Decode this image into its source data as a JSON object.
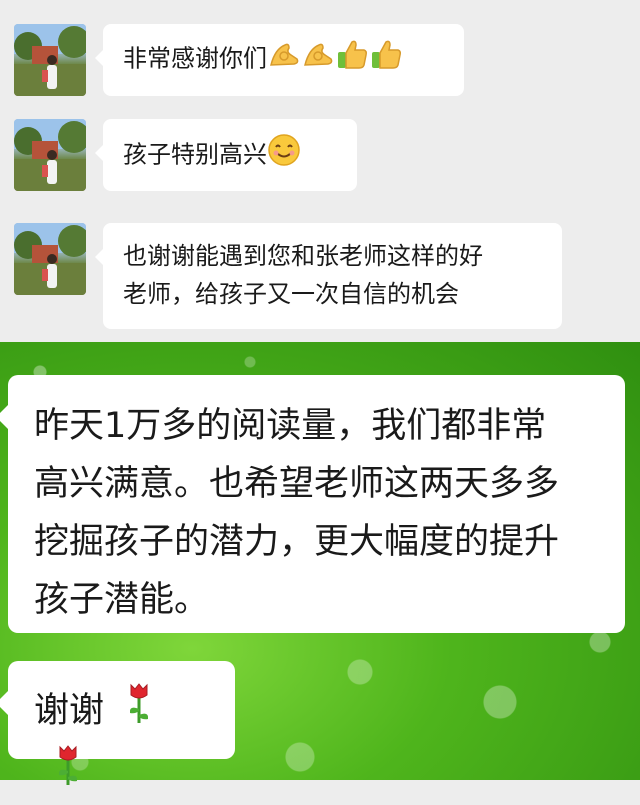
{
  "messages": [
    {
      "text": "非常感谢你们",
      "emojis": [
        "ok-hand-icon",
        "ok-hand-icon",
        "thumbs-up-icon",
        "thumbs-up-icon"
      ]
    },
    {
      "text": "孩子特别高兴",
      "emojis": [
        "smiling-face-icon"
      ]
    },
    {
      "lines": [
        "也谢谢能遇到您和张老师这样的好",
        "老师，给孩子又一次自信的机会"
      ]
    },
    {
      "lines": [
        "昨天1万多的阅读量，我们都非常",
        "高兴满意。也希望老师这两天多多",
        "挖掘孩子的潜力，更大幅度的提升",
        "孩子潜能。"
      ]
    },
    {
      "text": "谢谢",
      "emojis": [
        "rose-icon",
        "rose-icon"
      ]
    }
  ],
  "colors": {
    "chat_background": "#ededed",
    "bubble": "#ffffff",
    "wallpaper_green": "#4fb51c"
  }
}
